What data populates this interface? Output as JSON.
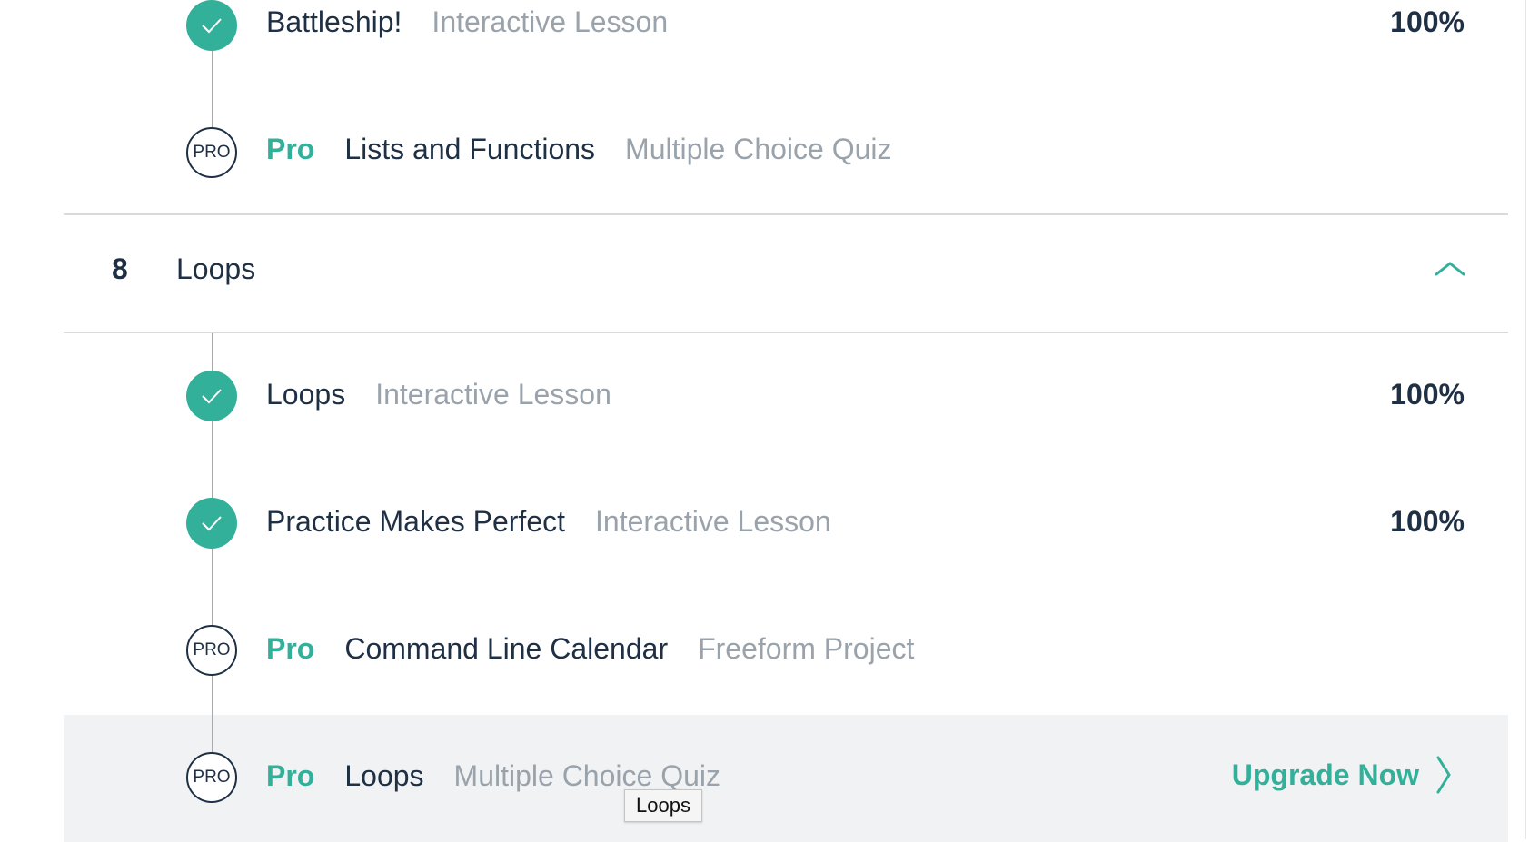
{
  "colors": {
    "accent": "#33b09a",
    "text": "#1f3044",
    "muted": "#9aa3ab",
    "hover_bg": "#f1f2f3"
  },
  "previous_section": {
    "items": [
      {
        "title": "Battleship!",
        "kind": "Interactive Lesson",
        "status": "completed",
        "progress": "100%",
        "icon": "check-icon"
      },
      {
        "pro_label": "Pro",
        "title": "Lists and Functions",
        "kind": "Multiple Choice Quiz",
        "status": "locked",
        "badge": "PRO"
      }
    ]
  },
  "section": {
    "number": "8",
    "title": "Loops",
    "toggle_icon": "chevron-up-icon",
    "items": [
      {
        "title": "Loops",
        "kind": "Interactive Lesson",
        "status": "completed",
        "progress": "100%",
        "icon": "check-icon"
      },
      {
        "title": "Practice Makes Perfect",
        "kind": "Interactive Lesson",
        "status": "completed",
        "progress": "100%",
        "icon": "check-icon"
      },
      {
        "pro_label": "Pro",
        "title": "Command Line Calendar",
        "kind": "Freeform Project",
        "status": "locked",
        "badge": "PRO"
      },
      {
        "pro_label": "Pro",
        "title": "Loops",
        "kind": "Multiple Choice Quiz",
        "status": "locked",
        "badge": "PRO",
        "action": "Upgrade Now",
        "action_icon": "chevron-right-icon"
      }
    ]
  },
  "tooltip": {
    "text": "Loops"
  }
}
